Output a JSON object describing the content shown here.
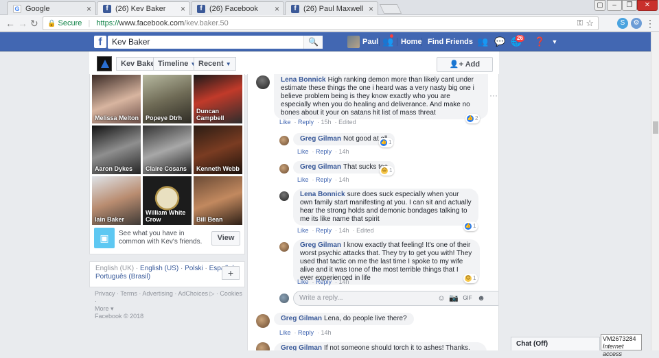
{
  "browser": {
    "tabs": [
      {
        "title": "Google",
        "favicon": "google-icon",
        "active": false
      },
      {
        "title": "(26) Kev Baker",
        "favicon": "facebook-icon",
        "active": true
      },
      {
        "title": "(26) Facebook",
        "favicon": "facebook-icon",
        "active": false
      },
      {
        "title": "(26) Paul Maxwell",
        "favicon": "facebook-icon",
        "active": false
      }
    ],
    "secure_label": "Secure",
    "url_scheme": "https://",
    "url_host": "www.facebook.com",
    "url_path": "/kev.baker.50"
  },
  "fb": {
    "search_value": "Kev Baker",
    "user_name": "Paul",
    "nav_home": "Home",
    "nav_find_friends": "Find Friends",
    "notifications_count": "26",
    "brand_color": "#4267b2"
  },
  "subbar": {
    "name": "Kev Baker",
    "timeline": "Timeline",
    "recent": "Recent",
    "add_friend": "Add Friend"
  },
  "friends": [
    {
      "name": "Melissa Melton"
    },
    {
      "name": "Popeye Dtrh"
    },
    {
      "name": "Duncan Campbell"
    },
    {
      "name": "Aaron Dykes"
    },
    {
      "name": "Claire Cosans"
    },
    {
      "name": "Kenneth Webb"
    },
    {
      "name": "Iain Baker"
    },
    {
      "name": "William White Crow"
    },
    {
      "name": "Bill Bean"
    }
  ],
  "common": {
    "text": "See what you have in common with Kev's friends.",
    "button": "View"
  },
  "languages": {
    "current": "English (UK)",
    "others": [
      "English (US)",
      "Polski",
      "Español",
      "Português (Brasil)"
    ]
  },
  "footer": {
    "links": [
      "Privacy",
      "Terms",
      "Advertising",
      "AdChoices",
      "Cookies",
      "More"
    ],
    "copyright": "Facebook © 2018"
  },
  "comments": [
    {
      "author": "Lena Bonnick",
      "text": "High ranking demon more than likely cant under estimate these things the one i heard was a very nasty big one i believe problem being is they know exactly who you are especially when you do healing and deliverance. And make no bones about it your on satans hit list of mass threat",
      "like": "Like",
      "reply": "Reply",
      "time": "15h",
      "edited": "Edited",
      "reactions": "2"
    },
    {
      "author": "Greg Gilman",
      "text": "Not good at all",
      "like": "Like",
      "reply": "Reply",
      "time": "14h",
      "reactions": "1"
    },
    {
      "author": "Greg Gilman",
      "text": "That sucks too",
      "like": "Like",
      "reply": "Reply",
      "time": "14h",
      "reactions": "1"
    },
    {
      "author": "Lena Bonnick",
      "text": "sure does suck especially when your own family start manifesting at you. I can sit and actually hear the strong holds and demonic bondages talking to me its like name that spirit",
      "like": "Like",
      "reply": "Reply",
      "time": "14h",
      "edited": "Edited",
      "reactions": "1"
    },
    {
      "author": "Greg Gilman",
      "text": "I know exactly that feeling! It's one of their worst psychic attacks that. They try to get you with! They used that tactic on me the last time I spoke to my wife alive and it was Ione of the most terrible things that I ever experienced in life",
      "like": "Like",
      "reply": "Reply",
      "time": "14h",
      "reactions": "1"
    },
    {
      "author": "Greg Gilman",
      "text": "Lena, do people live there?",
      "like": "Like",
      "reply": "Reply",
      "time": "14h"
    },
    {
      "author": "Greg Gilman",
      "text": "If not someone should torch it to ashes! Thanks. For"
    }
  ],
  "reply_placeholder": "Write a reply...",
  "chat_label": "Chat (Off)",
  "overlay": {
    "id": "VM2673284",
    "status": "Internet access"
  }
}
